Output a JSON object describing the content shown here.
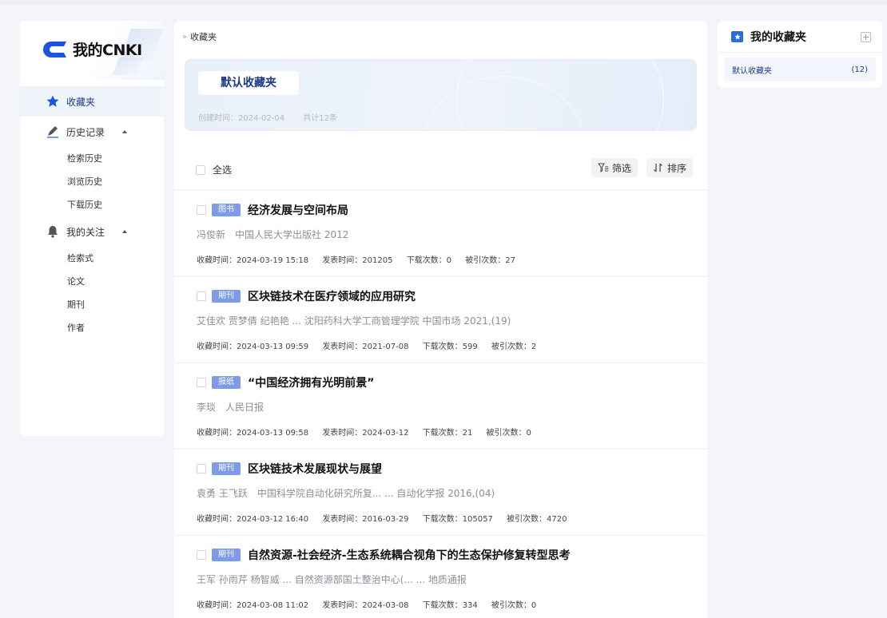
{
  "brand": {
    "name": "我的CNKI"
  },
  "sidebar": {
    "favorites": "收藏夹",
    "history": {
      "label": "历史记录",
      "items": [
        "检索历史",
        "浏览历史",
        "下载历史"
      ]
    },
    "follows": {
      "label": "我的关注",
      "items": [
        "检索式",
        "论文",
        "期刊",
        "作者"
      ]
    }
  },
  "breadcrumb": "收藏夹",
  "folder": {
    "name": "默认收藏夹",
    "created": "创建时间：2024-02-04",
    "total": "共计12条"
  },
  "toolbar": {
    "select_all": "全选",
    "filter": "筛选",
    "sort": "排序"
  },
  "results": [
    {
      "type": "图书",
      "title": "经济发展与空间布局",
      "meta": "冯俊新　中国人民大学出版社  2012",
      "saved": "收藏时间：2024-03-19 15:18",
      "published": "发表时间：201205",
      "downloads": "下载次数：0",
      "cited": "被引次数：27"
    },
    {
      "type": "期刊",
      "title": "区块链技术在医疗领域的应用研究",
      "meta": "艾佳欢 贾梦倩 纪艳艳 ...  沈阳药科大学工商管理学院  中国市场  2021,(19)",
      "saved": "收藏时间：2024-03-13 09:59",
      "published": "发表时间：2021-07-08",
      "downloads": "下载次数：599",
      "cited": "被引次数：2"
    },
    {
      "type": "报纸",
      "title": "“中国经济拥有光明前景”",
      "meta": "李琰　人民日报",
      "saved": "收藏时间：2024-03-13 09:58",
      "published": "发表时间：2024-03-12",
      "downloads": "下载次数：21",
      "cited": "被引次数：0"
    },
    {
      "type": "期刊",
      "title": "区块链技术发展现状与展望",
      "meta": "袁勇 王飞跃　中国科学院自动化研究所复... ...  自动化学报  2016,(04)",
      "saved": "收藏时间：2024-03-12 16:40",
      "published": "发表时间：2016-03-29",
      "downloads": "下载次数：105057",
      "cited": "被引次数：4720"
    },
    {
      "type": "期刊",
      "title": "自然资源-社会经济-生态系统耦合视角下的生态保护修复转型思考",
      "meta": "王军 孙雨芹 杨智威 ...  自然资源部国土整治中心(...  ...  地质通报",
      "saved": "收藏时间：2024-03-08 11:02",
      "published": "发表时间：2024-03-08",
      "downloads": "下载次数：334",
      "cited": "被引次数：0"
    }
  ],
  "right_panel": {
    "title": "我的收藏夹",
    "folders": [
      {
        "name": "默认收藏夹",
        "count": "(12)"
      }
    ]
  },
  "colors": {
    "brand_blue": "#1a56db",
    "badge": "#7d9be8",
    "accent_text": "#1a3a8a"
  }
}
